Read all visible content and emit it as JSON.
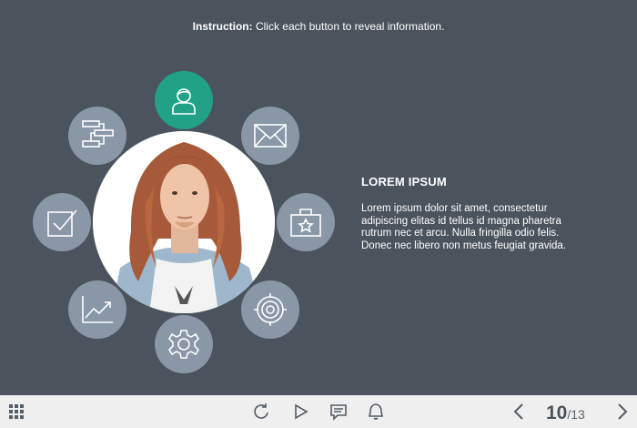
{
  "instruction": {
    "label": "Instruction:",
    "text": " Click each button to reveal information."
  },
  "info": {
    "title": "LOREM IPSUM",
    "body": "Lorem ipsum dolor sit amet, consectetur adipiscing elitas id tellus id magna pharetra rutrum nec et arcu. Nulla fringilla odio felis. Donec nec libero non metus feugiat gravida."
  },
  "buttons": [
    {
      "icon": "user-icon",
      "active": true
    },
    {
      "icon": "mail-icon",
      "active": false
    },
    {
      "icon": "briefcase-star-icon",
      "active": false
    },
    {
      "icon": "target-icon",
      "active": false
    },
    {
      "icon": "gear-icon",
      "active": false
    },
    {
      "icon": "chart-icon",
      "active": false
    },
    {
      "icon": "checkbox-icon",
      "active": false
    },
    {
      "icon": "flowchart-icon",
      "active": false
    }
  ],
  "colors": {
    "background": "#4b535c",
    "button": "#8997a6",
    "active": "#21a287",
    "bar": "#efefef"
  },
  "pagination": {
    "current": "10",
    "total": "/13"
  },
  "toolbar": [
    "grid-menu-icon",
    "replay-icon",
    "play-icon",
    "comment-icon",
    "bell-icon",
    "prev-arrow-icon",
    "next-arrow-icon"
  ]
}
